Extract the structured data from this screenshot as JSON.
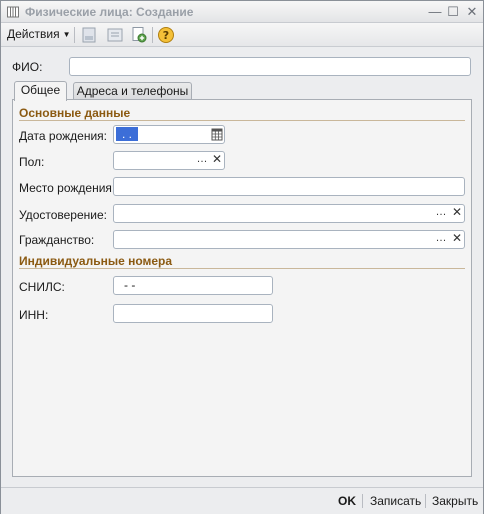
{
  "window": {
    "title": "Физические лица: Создание"
  },
  "toolbar": {
    "actions_label": "Действия",
    "icons": [
      "save-doc-icon",
      "structure-icon",
      "copy-add-icon",
      "help-icon"
    ]
  },
  "fio": {
    "label": "ФИО:",
    "value": ""
  },
  "tabs": [
    {
      "label": "Общее",
      "active": true
    },
    {
      "label": "Адреса и телефоны",
      "active": false
    }
  ],
  "main": {
    "section_title": "Основные данные",
    "birth_date": {
      "label": "Дата рождения:",
      "value": ". ."
    },
    "gender": {
      "label": "Пол:",
      "value": ""
    },
    "birth_place": {
      "label": "Место рождения:",
      "value": ""
    },
    "id_doc": {
      "label": "Удостоверение:",
      "value": ""
    },
    "citizenship": {
      "label": "Гражданство:",
      "value": ""
    }
  },
  "numbers": {
    "section_title": "Индивидуальные номера",
    "snils": {
      "label": "СНИЛС:",
      "value": "-  -"
    },
    "inn": {
      "label": "ИНН:",
      "value": ""
    }
  },
  "bottom": {
    "ok": "OK",
    "save": "Записать",
    "close": "Закрыть"
  },
  "colors": {
    "section": "#8b5a12",
    "accent": "#3c6ed8"
  }
}
